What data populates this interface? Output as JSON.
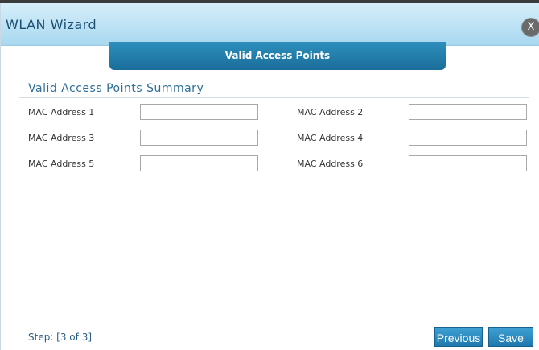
{
  "dialog": {
    "title": "WLAN Wizard",
    "close_label": "X"
  },
  "banner": {
    "label": "Valid Access Points"
  },
  "section": {
    "title": "Valid Access Points Summary"
  },
  "fields": [
    {
      "label": "MAC Address 1",
      "value": ""
    },
    {
      "label": "MAC Address 2",
      "value": ""
    },
    {
      "label": "MAC Address 3",
      "value": ""
    },
    {
      "label": "MAC Address 4",
      "value": ""
    },
    {
      "label": "MAC Address 5",
      "value": ""
    },
    {
      "label": "MAC Address 6",
      "value": ""
    }
  ],
  "footer": {
    "step": "Step: [3 of 3]",
    "previous_label": "Previous",
    "save_label": "Save"
  }
}
